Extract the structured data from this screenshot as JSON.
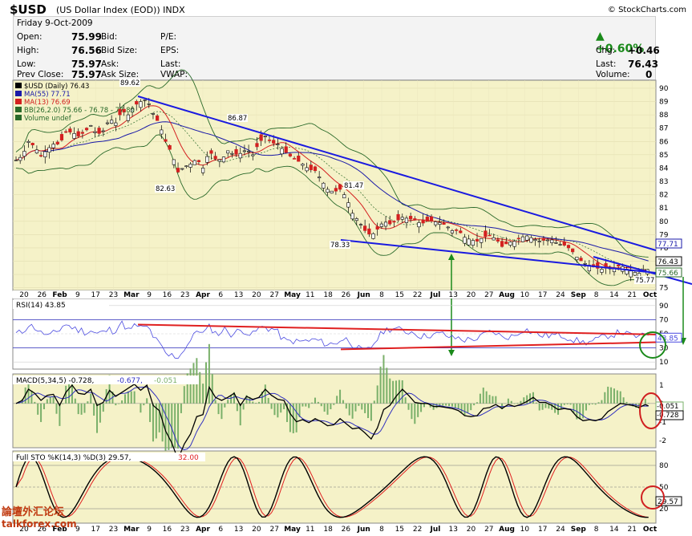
{
  "header": {
    "symbol": "$USD",
    "name": "(US Dollar Index (EOD))",
    "exchange": "INDX",
    "copyright": "© StockCharts.com",
    "date": "Friday  9-Oct-2009",
    "open_label": "Open:",
    "open": "75.99",
    "high_label": "High:",
    "high": "76.56",
    "low_label": "Low:",
    "low": "75.97",
    "prev_label": "Prev Close:",
    "prev": "75.97",
    "bid_label": "Bid:",
    "bidsize_label": "Bid Size:",
    "ask_label": "Ask:",
    "asksize_label": "Ask Size:",
    "pe_label": "P/E:",
    "eps_label": "EPS:",
    "last_label": "Last:",
    "vwap_label": "VWAP:",
    "pct_change": "▲ +0.60%",
    "chg_label": "Chg:",
    "chg": "+0.46",
    "last2_label": "Last:",
    "last": "76.43",
    "volume_label": "Volume:",
    "volume": "0"
  },
  "price_panel": {
    "legend": [
      {
        "text": "$USD (Daily) 76.43",
        "color": "#000000"
      },
      {
        "text": "MA(55) 77.71",
        "color": "#1a1aa8"
      },
      {
        "text": "MA(13) 76.69",
        "color": "#d42020"
      },
      {
        "text": "BB(26,2.0) 75.66 - 76.78 - 77.89",
        "color": "#2a6a2a"
      },
      {
        "text": "Volume undef",
        "color": "#2a6a2a"
      }
    ],
    "price_labels": [
      {
        "text": "89.62",
        "value": 89.62
      },
      {
        "text": "86.87",
        "value": 86.87
      },
      {
        "text": "82.63",
        "value": 82.63
      },
      {
        "text": "81.47",
        "value": 81.47
      },
      {
        "text": "78.33",
        "value": 78.33
      },
      {
        "text": "75.77",
        "value": 75.77
      }
    ],
    "y_ticks": [
      "90",
      "89",
      "88",
      "87",
      "86",
      "85",
      "84",
      "83",
      "82",
      "81",
      "80",
      "79",
      "78",
      "77",
      "76",
      "75"
    ],
    "right_tags": [
      {
        "text": "77.71",
        "color": "#1a1aa8"
      },
      {
        "text": "76.43",
        "color": "#000000"
      },
      {
        "text": "75.66",
        "color": "#2a6a2a"
      }
    ]
  },
  "x_axis": {
    "labels": [
      "20",
      "26",
      "Feb",
      "9",
      "17",
      "23",
      "Mar",
      "9",
      "16",
      "23",
      "Apr",
      "6",
      "13",
      "20",
      "27",
      "May",
      "11",
      "18",
      "26",
      "Jun",
      "8",
      "15",
      "22",
      "Jul",
      "13",
      "20",
      "27",
      "Aug",
      "10",
      "17",
      "24",
      "Sep",
      "8",
      "14",
      "21",
      "Oct"
    ]
  },
  "rsi_panel": {
    "legend": "RSI(14) 43.85",
    "y_ticks": [
      "90",
      "70",
      "50",
      "30",
      "10"
    ],
    "tag": "43.85"
  },
  "macd_panel": {
    "legend_main": "MACD(5,34,5) -0.728,",
    "legend_signal": "-0.677,",
    "legend_hist": "-0.051",
    "y_ticks": [
      "1",
      "0",
      "-1",
      "-2"
    ],
    "tags": [
      "-0.051",
      "-0.728"
    ]
  },
  "sto_panel": {
    "legend_k": "Full STO %K(14,3) %D(3) 29.57,",
    "legend_d": "32.00",
    "y_ticks": [
      "80",
      "50",
      "20"
    ],
    "tag": "29.57"
  },
  "watermark": {
    "line1": "論壇外汇论坛",
    "line2": "talkforex.com"
  },
  "chart_data": {
    "type": "line",
    "title": "$USD (Daily) 76.43",
    "ylim": [
      74.8,
      90.6
    ],
    "price_path": [
      [
        0,
        84.6
      ],
      [
        6,
        84.9
      ],
      [
        12,
        86.0
      ],
      [
        18,
        85.6
      ],
      [
        24,
        84.9
      ],
      [
        30,
        85.4
      ],
      [
        36,
        85.8
      ],
      [
        42,
        85.8
      ],
      [
        48,
        86.7
      ],
      [
        54,
        86.7
      ],
      [
        60,
        86.4
      ],
      [
        66,
        86.7
      ],
      [
        72,
        87.2
      ],
      [
        78,
        86.5
      ],
      [
        84,
        86.8
      ],
      [
        90,
        87.7
      ],
      [
        96,
        87.4
      ],
      [
        102,
        88.3
      ],
      [
        108,
        88.0
      ],
      [
        114,
        88.7
      ],
      [
        120,
        89.0
      ],
      [
        126,
        89.2
      ],
      [
        132,
        88.1
      ],
      [
        138,
        87.3
      ],
      [
        144,
        86.0
      ],
      [
        150,
        85.1
      ],
      [
        156,
        83.7
      ],
      [
        162,
        84.1
      ],
      [
        168,
        84.3
      ],
      [
        174,
        84.7
      ],
      [
        180,
        84.0
      ],
      [
        186,
        85.3
      ],
      [
        192,
        84.7
      ],
      [
        198,
        84.6
      ],
      [
        204,
        85.3
      ],
      [
        210,
        85.0
      ],
      [
        216,
        85.1
      ],
      [
        222,
        85.4
      ],
      [
        228,
        85.0
      ],
      [
        234,
        85.9
      ],
      [
        240,
        86.4
      ],
      [
        246,
        85.9
      ],
      [
        252,
        85.8
      ],
      [
        258,
        85.3
      ],
      [
        264,
        84.9
      ],
      [
        270,
        84.6
      ],
      [
        276,
        84.3
      ],
      [
        282,
        83.9
      ],
      [
        288,
        83.8
      ],
      [
        294,
        83.1
      ],
      [
        300,
        82.4
      ],
      [
        306,
        82.2
      ],
      [
        312,
        82.4
      ],
      [
        318,
        81.8
      ],
      [
        324,
        80.6
      ],
      [
        330,
        80.0
      ],
      [
        336,
        79.3
      ],
      [
        342,
        78.9
      ],
      [
        348,
        79.4
      ],
      [
        354,
        80.0
      ],
      [
        360,
        79.8
      ],
      [
        366,
        80.0
      ],
      [
        372,
        80.3
      ],
      [
        378,
        80.2
      ],
      [
        384,
        80.1
      ],
      [
        390,
        79.8
      ],
      [
        396,
        80.0
      ],
      [
        402,
        80.0
      ],
      [
        408,
        79.9
      ],
      [
        414,
        79.7
      ],
      [
        420,
        79.3
      ],
      [
        426,
        79.3
      ],
      [
        432,
        78.8
      ],
      [
        438,
        78.6
      ],
      [
        444,
        78.5
      ],
      [
        450,
        78.8
      ],
      [
        456,
        78.9
      ],
      [
        462,
        78.7
      ],
      [
        468,
        78.1
      ],
      [
        474,
        78.4
      ],
      [
        480,
        78.5
      ],
      [
        486,
        78.8
      ],
      [
        492,
        78.9
      ],
      [
        498,
        78.7
      ],
      [
        504,
        78.5
      ],
      [
        510,
        78.6
      ],
      [
        516,
        78.6
      ],
      [
        522,
        78.3
      ],
      [
        528,
        78.2
      ],
      [
        534,
        77.9
      ],
      [
        540,
        77.3
      ],
      [
        546,
        76.9
      ],
      [
        552,
        76.7
      ],
      [
        558,
        76.5
      ],
      [
        564,
        76.4
      ],
      [
        570,
        76.5
      ],
      [
        576,
        76.5
      ],
      [
        582,
        76.7
      ],
      [
        588,
        76.4
      ],
      [
        594,
        76.2
      ],
      [
        600,
        76.1
      ],
      [
        606,
        76.4
      ]
    ]
  }
}
